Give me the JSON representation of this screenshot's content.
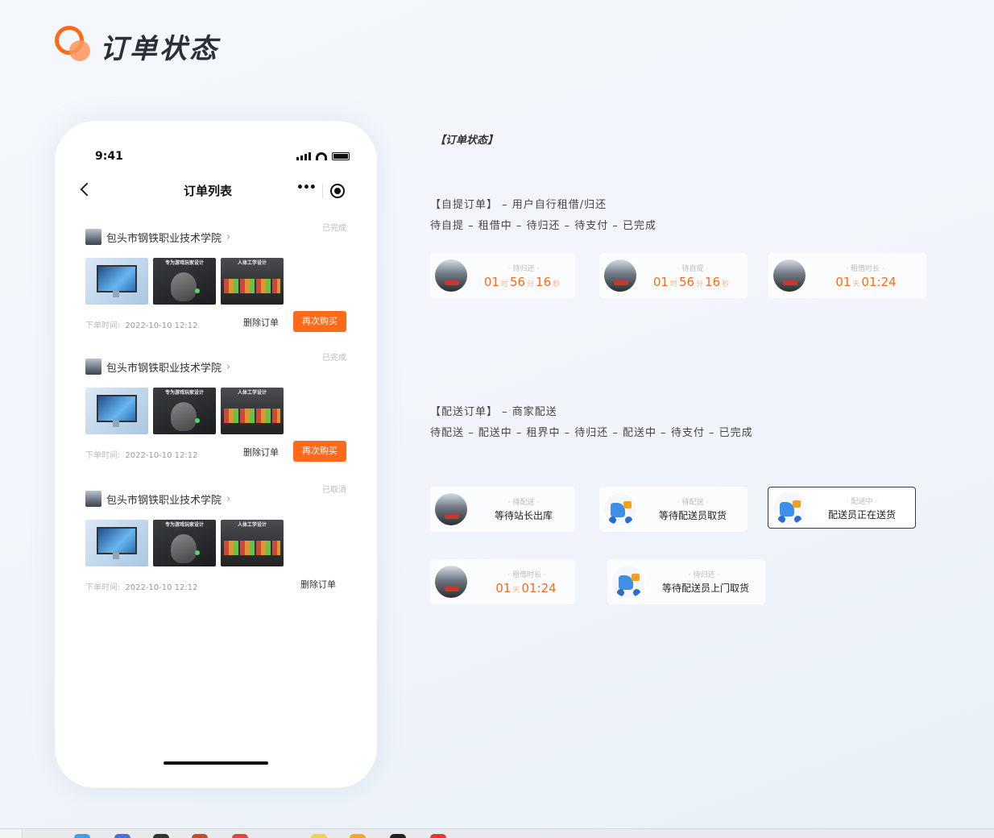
{
  "header": {
    "title": "订单状态",
    "accent_color": "#ff6a1a"
  },
  "phone": {
    "status_time": "9:41",
    "nav_title": "订单列表",
    "nav_more": "•••",
    "orders": [
      {
        "status": "已完成",
        "shop": "包头市钢铁职业技术学院",
        "time_label": "下单时间:",
        "time": "2022-10-10 12:12",
        "delete_label": "删除订单",
        "rebuy_label": "再次购买",
        "thumb_caption_2": "专为游戏玩家设计",
        "thumb_caption_3": "人体工学设计"
      },
      {
        "status": "已完成",
        "shop": "包头市钢铁职业技术学院",
        "time_label": "下单时间:",
        "time": "2022-10-10 12:12",
        "delete_label": "删除订单",
        "rebuy_label": "再次购买",
        "thumb_caption_2": "专为游戏玩家设计",
        "thumb_caption_3": "人体工学设计"
      },
      {
        "status": "已取消",
        "shop": "包头市钢铁职业技术学院",
        "time_label": "下单时间:",
        "time": "2022-10-10 12:12",
        "delete_label": "删除订单",
        "thumb_caption_2": "专为游戏玩家设计",
        "thumb_caption_3": "人体工学设计"
      }
    ]
  },
  "annotations": {
    "section_title": "【订单状态】",
    "pickup_title": "【自提订单】 – 用户自行租借/归还",
    "pickup_flow": "待自提 – 租借中 – 待归还 – 待支付 – 已完成",
    "delivery_title": "【配送订单】 – 商家配送",
    "delivery_flow": "待配送 – 配送中 – 租界中 – 待归还 – 配送中 – 待支付 – 已完成"
  },
  "pickup_chips": [
    {
      "label": "· 待归还 ·",
      "v1": "01",
      "u1": "时",
      "v2": "56",
      "u2": "分",
      "v3": "16",
      "u3": "秒"
    },
    {
      "label": "· 待自提 ·",
      "v1": "01",
      "u1": "时",
      "v2": "56",
      "u2": "分",
      "v3": "16",
      "u3": "秒"
    },
    {
      "label": "· 租借时长 ·",
      "v1": "01",
      "u1": "天",
      "v2": "01:24"
    }
  ],
  "delivery_chips": [
    {
      "label": "· 待配送 ·",
      "text": "等待站长出库"
    },
    {
      "label": "· 待配送 ·",
      "text": "等待配送员取货"
    },
    {
      "label": "· 配送中 ·",
      "text": "配送员正在送货"
    },
    {
      "label": "· 租借时长 ·",
      "v1": "01",
      "u1": "天",
      "v2": "01:24"
    },
    {
      "label": "· 待归还 ·",
      "text": "等待配送员上门取货"
    }
  ]
}
